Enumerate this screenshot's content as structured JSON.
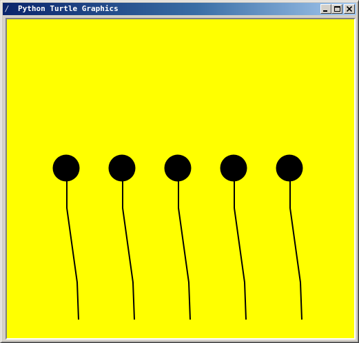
{
  "window": {
    "title": "Python Turtle Graphics",
    "icon": "feather-icon"
  },
  "controls": {
    "minimize_icon": "minimize-icon",
    "maximize_icon": "maximize-icon",
    "close_icon": "close-icon"
  },
  "canvas": {
    "background_color": "#ffff00",
    "ink_color": "#000000",
    "figure_count": 5
  }
}
